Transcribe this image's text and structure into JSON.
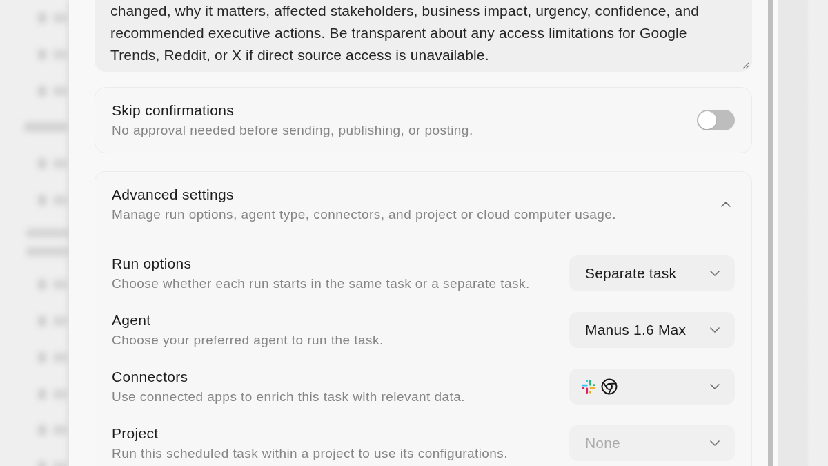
{
  "prompt": {
    "value": "changed, why it matters, affected stakeholders, business impact, urgency, confidence, and recommended executive actions. Be transparent about any access limitations for Google Trends, Reddit, or X if direct source access is unavailable."
  },
  "skip_confirmations": {
    "title": "Skip confirmations",
    "description": "No approval needed before sending, publishing, or posting.",
    "on": false
  },
  "advanced_settings": {
    "title": "Advanced settings",
    "description": "Manage run options, agent type, connectors, and project or cloud computer usage.",
    "expanded": true,
    "rows": [
      {
        "title": "Run options",
        "description": "Choose whether each run starts in the same task or a separate task.",
        "dropdown": {
          "value": "Separate task"
        }
      },
      {
        "title": "Agent",
        "description": "Choose your preferred agent to run the task.",
        "dropdown": {
          "value": "Manus 1.6 Max"
        }
      },
      {
        "title": "Connectors",
        "description": "Use connected apps to enrich this task with relevant data.",
        "dropdown": {
          "icons": [
            {
              "kind": "hash"
            },
            {
              "kind": "aperture"
            }
          ]
        }
      },
      {
        "title": "Project",
        "description": "Run this scheduled task within a project to use its configurations.",
        "dropdown": {
          "placeholder": "None"
        }
      }
    ]
  }
}
